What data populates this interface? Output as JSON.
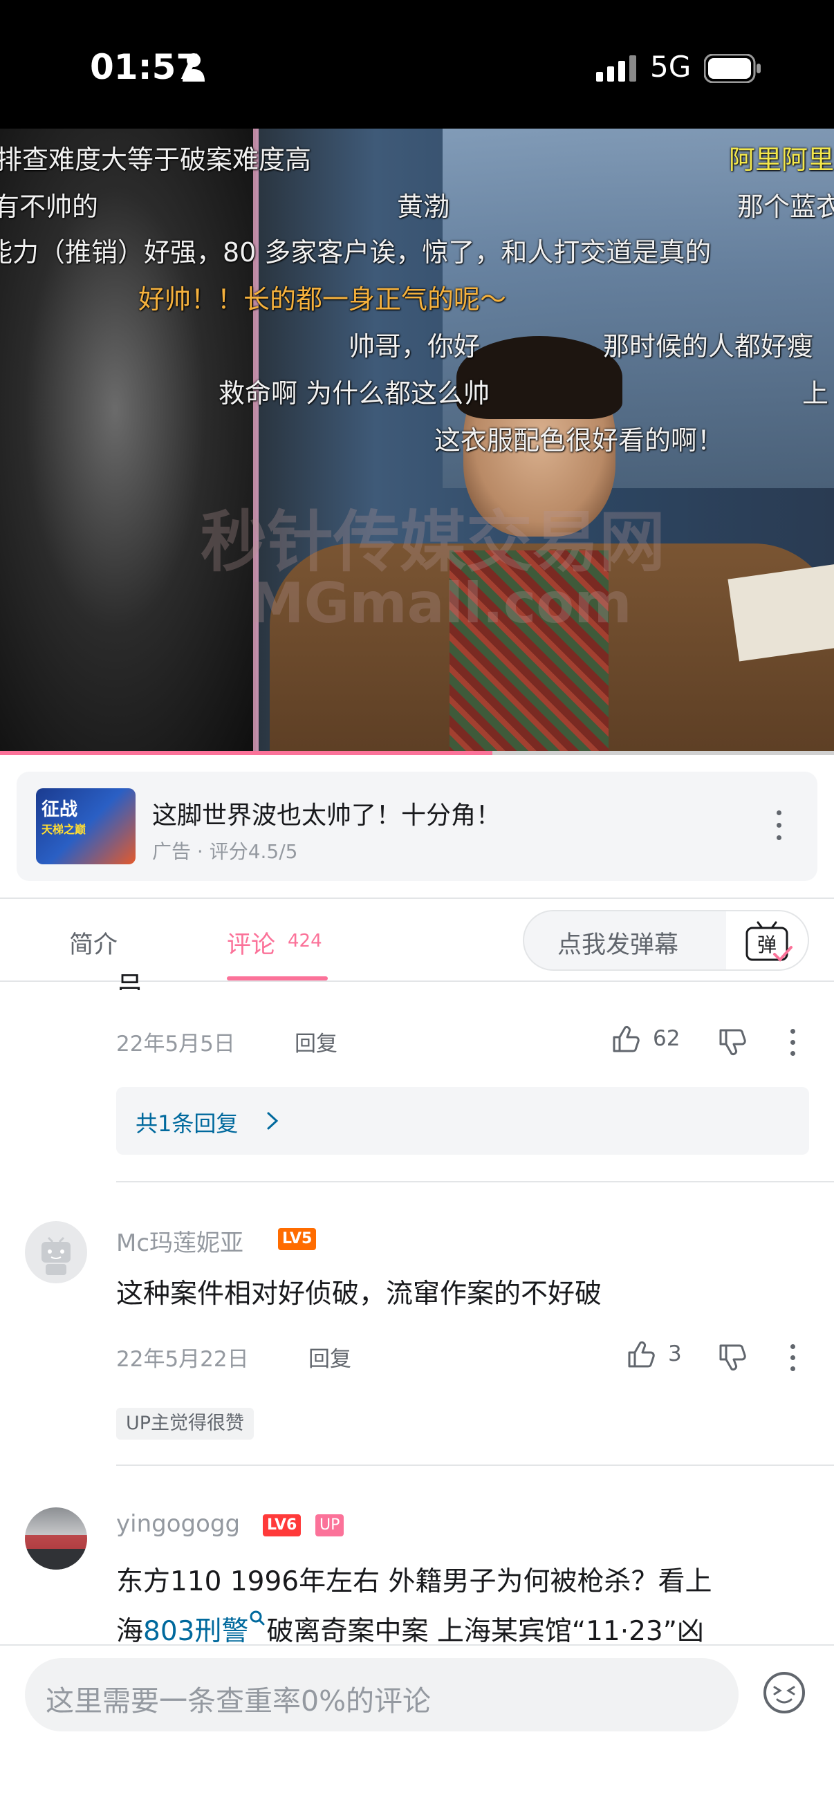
{
  "status_bar": {
    "time": "01:57",
    "network": "5G"
  },
  "video": {
    "danmaku": [
      {
        "text": "排查难度大等于破案难度高",
        "style": "white"
      },
      {
        "text": "阿里阿里",
        "style": "yellow"
      },
      {
        "text": "有不帅的",
        "style": "white"
      },
      {
        "text": "黄渤",
        "style": "white"
      },
      {
        "text": "那个蓝衣",
        "style": "white"
      },
      {
        "text": "能力（推销）好强，80 多家客户诶，惊了，和人打交道是真的",
        "style": "white"
      },
      {
        "text": "好帅！！长的都一身正气的呢～",
        "style": "orange"
      },
      {
        "text": "帅哥，你好",
        "style": "white"
      },
      {
        "text": "那时候的人都好瘦",
        "style": "white"
      },
      {
        "text": "救命啊 为什么都这么帅",
        "style": "white"
      },
      {
        "text": "上",
        "style": "white"
      },
      {
        "text": "这衣服配色很好看的啊！",
        "style": "white"
      }
    ],
    "watermark_line1": "秒针传媒交易网",
    "watermark_line2": "MGmall.com",
    "progress_fraction": 0.59
  },
  "ad": {
    "thumb_title": "征战",
    "thumb_subtitle": "天梯之巅",
    "title": "这脚世界波也太帅了！十分角！",
    "subtitle": "广告 · 评分4.5/5"
  },
  "tabs": {
    "intro": "简介",
    "comments": "评论",
    "comments_count": "424",
    "danmaku_placeholder": "点我发弹幕",
    "danmaku_icon_label": "弹"
  },
  "comments": [
    {
      "partial_text": "吕",
      "date": "22年5月5日",
      "reply_label": "回复",
      "likes": "62",
      "replies_summary": "共1条回复"
    },
    {
      "username": "Mc玛莲妮亚",
      "level": "LV5",
      "text": "这种案件相对好侦破，流窜作案的不好破",
      "date": "22年5月22日",
      "reply_label": "回复",
      "likes": "3",
      "tag": "UP主觉得很赞"
    },
    {
      "username": "yingogogg",
      "level": "LV6",
      "up_badge": "UP",
      "text_line1": "东方110 1996年左右  外籍男子为何被枪杀？看上",
      "text_line2_prefix": "海",
      "text_line2_link": "803刑警",
      "text_line2_suffix": "破离奇案中案 上海某宾馆“11·23”凶"
    }
  ],
  "bottom_bar": {
    "placeholder": "这里需要一条查重率0%的评论"
  },
  "colors": {
    "accent": "#fb7299",
    "link": "#00699d",
    "text": "#18191c",
    "muted": "#9499a0"
  }
}
